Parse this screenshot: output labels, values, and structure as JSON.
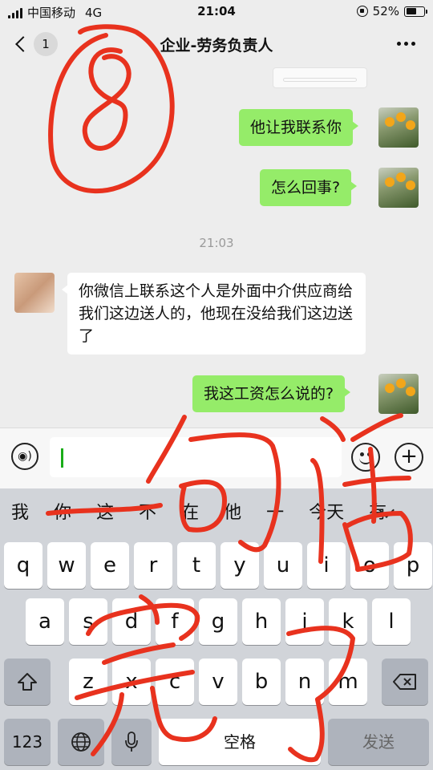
{
  "status_bar": {
    "carrier": "中国移动",
    "network": "4G",
    "time": "21:04",
    "battery": "52%"
  },
  "header": {
    "unread_count": "1",
    "title": "企业-劳务负责人"
  },
  "messages": [
    {
      "from": "me",
      "text": "他让我联系你"
    },
    {
      "from": "me",
      "text": "怎么回事?"
    },
    {
      "from": "other",
      "text": "你微信上联系这个人是外面中介供应商给我们这边送人的，他现在没给我们这边送了"
    },
    {
      "from": "me",
      "text": "我这工资怎么说的?"
    }
  ],
  "timestamp": "21:03",
  "input": {
    "voice_label": "◉)",
    "plus_label": "+"
  },
  "keyboard": {
    "suggestions": [
      "我",
      "你",
      "这",
      "不",
      "在",
      "他",
      "一",
      "今天",
      "有"
    ],
    "row1": [
      "q",
      "w",
      "e",
      "r",
      "t",
      "y",
      "u",
      "i",
      "o",
      "p"
    ],
    "row2": [
      "a",
      "s",
      "d",
      "f",
      "g",
      "h",
      "j",
      "k",
      "l"
    ],
    "row3": [
      "z",
      "x",
      "c",
      "v",
      "b",
      "n",
      "m"
    ],
    "numbers_label": "123",
    "space_label": "空格",
    "send_label": "发送"
  },
  "colors": {
    "bubble_me": "#95ec69",
    "bubble_other": "#ffffff",
    "scribble": "#e8321e"
  }
}
